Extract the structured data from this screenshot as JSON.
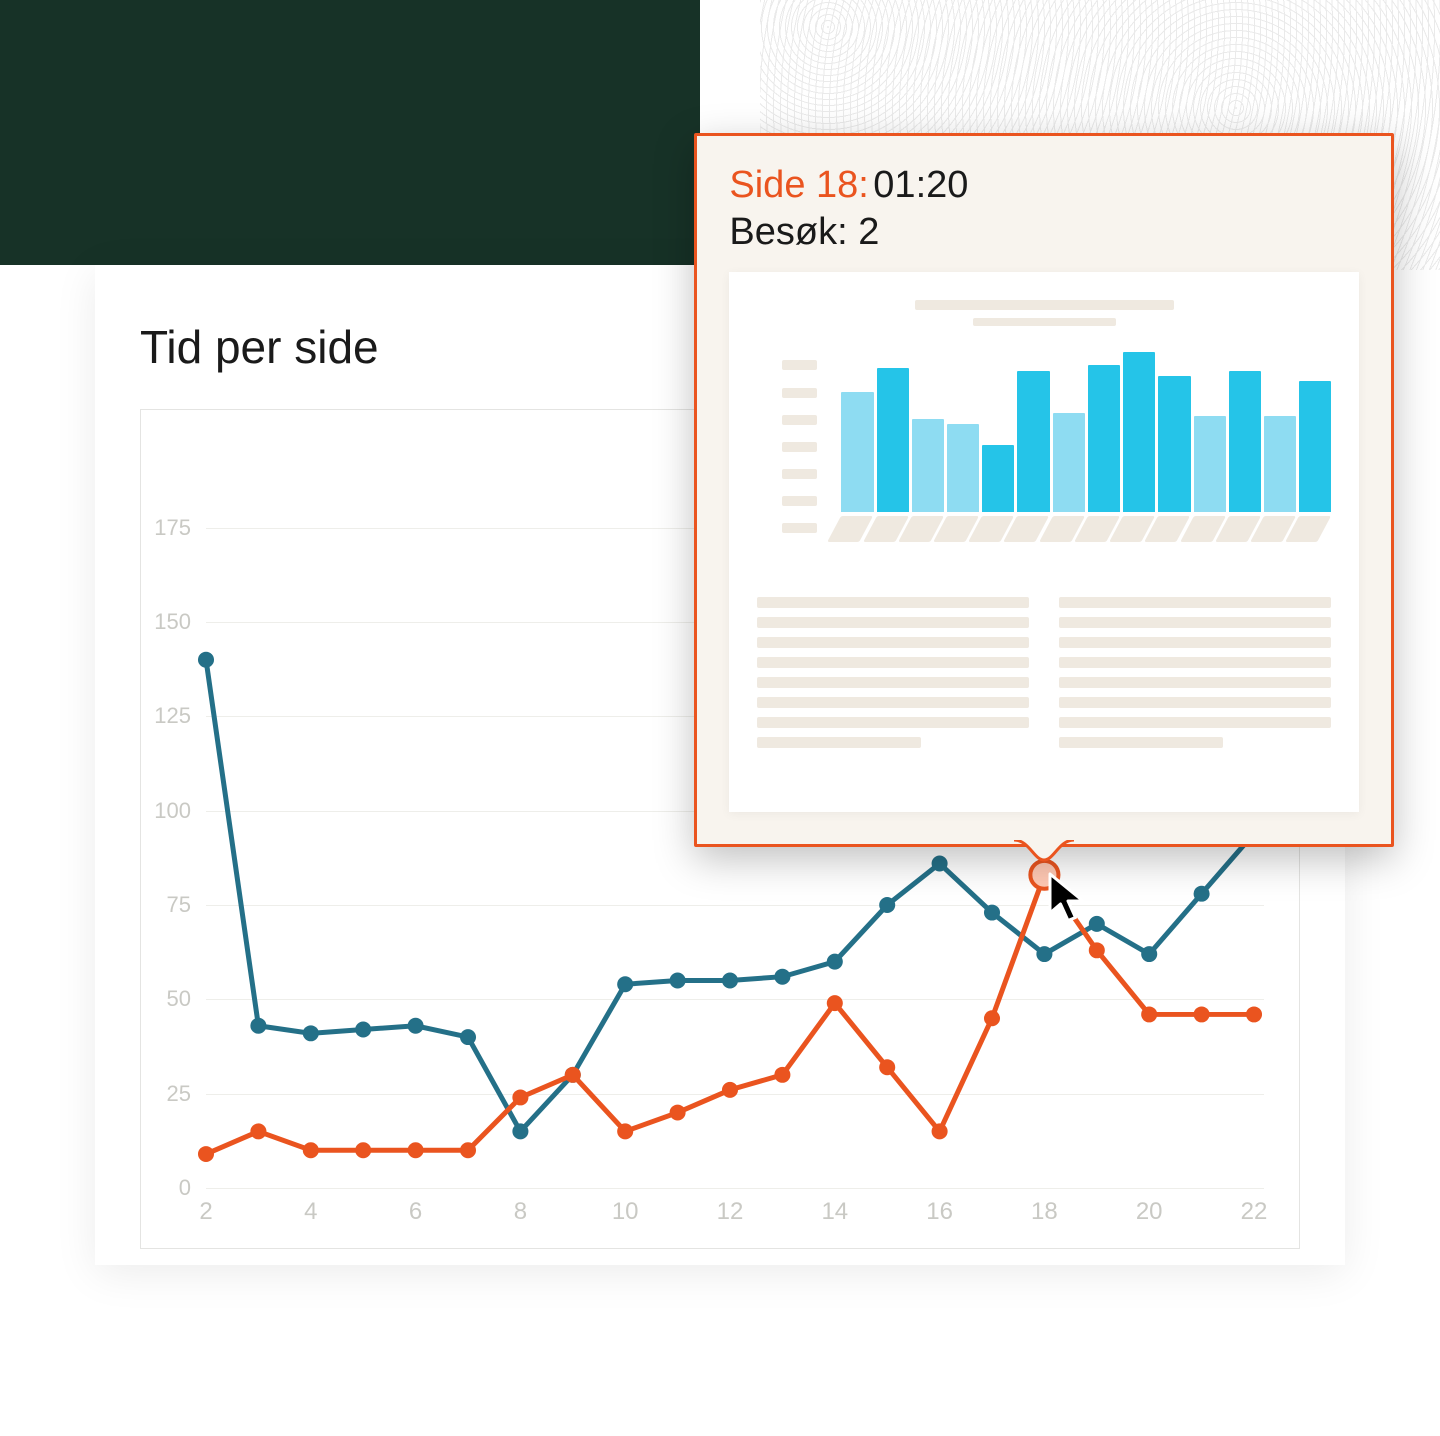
{
  "title": "Tid per side",
  "tooltip": {
    "page_label": "Side 18:",
    "time_value": "01:20",
    "visits_label": "Besøk:",
    "visits_value": "2"
  },
  "chart_data": {
    "type": "line",
    "title": "Tid per side",
    "xlabel": "",
    "ylabel": "",
    "ylim": [
      0,
      185
    ],
    "x": [
      2,
      3,
      4,
      5,
      6,
      7,
      8,
      9,
      10,
      11,
      12,
      13,
      14,
      15,
      16,
      17,
      18,
      19,
      20,
      21,
      22
    ],
    "x_ticks": [
      2,
      4,
      6,
      8,
      10,
      12,
      14,
      16,
      18,
      20,
      22
    ],
    "y_ticks": [
      0,
      25,
      50,
      75,
      100,
      125,
      150,
      175
    ],
    "series": [
      {
        "name": "series_teal",
        "color": "#247088",
        "values": [
          140,
          43,
          41,
          42,
          43,
          40,
          15,
          30,
          54,
          55,
          55,
          56,
          60,
          75,
          86,
          73,
          62,
          70,
          62,
          78,
          94
        ]
      },
      {
        "name": "series_orange",
        "color": "#ea541f",
        "values": [
          9,
          15,
          10,
          10,
          10,
          10,
          24,
          30,
          15,
          20,
          26,
          30,
          49,
          32,
          15,
          45,
          83,
          63,
          46,
          46,
          46
        ]
      }
    ],
    "hover_point": {
      "series": "series_orange",
      "x": 18,
      "y": 83
    }
  },
  "mini_bars": [
    {
      "h": 0.75,
      "shade": "light"
    },
    {
      "h": 0.9,
      "shade": "dark"
    },
    {
      "h": 0.58,
      "shade": "light"
    },
    {
      "h": 0.55,
      "shade": "light"
    },
    {
      "h": 0.42,
      "shade": "dark"
    },
    {
      "h": 0.88,
      "shade": "dark"
    },
    {
      "h": 0.62,
      "shade": "light"
    },
    {
      "h": 0.92,
      "shade": "dark"
    },
    {
      "h": 1.0,
      "shade": "dark"
    },
    {
      "h": 0.85,
      "shade": "dark"
    },
    {
      "h": 0.6,
      "shade": "light"
    },
    {
      "h": 0.88,
      "shade": "dark"
    },
    {
      "h": 0.6,
      "shade": "light"
    },
    {
      "h": 0.82,
      "shade": "dark"
    }
  ]
}
